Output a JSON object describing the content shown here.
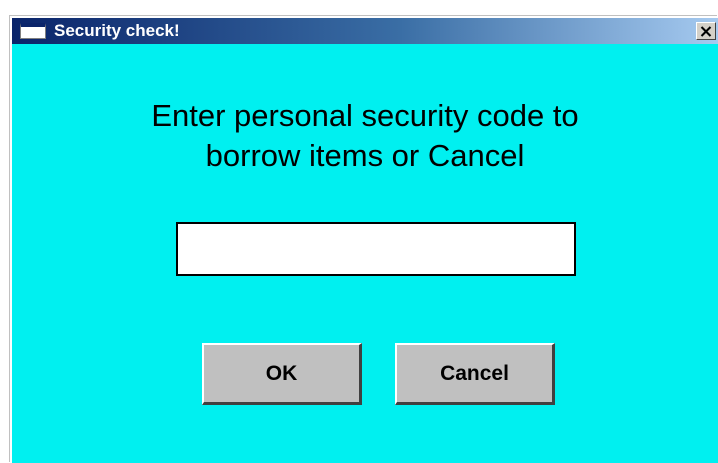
{
  "window": {
    "title": "Security check!",
    "close_glyph": "✕"
  },
  "dialog": {
    "prompt_line1": "Enter personal security code to",
    "prompt_line2": "borrow items or Cancel",
    "code_input": {
      "value": "",
      "placeholder": ""
    },
    "ok_label": "OK",
    "cancel_label": "Cancel"
  },
  "colors": {
    "background": "#00f0f0",
    "titlebar_start": "#0a246a",
    "titlebar_end": "#a6caf0",
    "button_face": "#c0c0c0"
  },
  "icons": [
    "window-app-icon",
    "close-icon"
  ]
}
